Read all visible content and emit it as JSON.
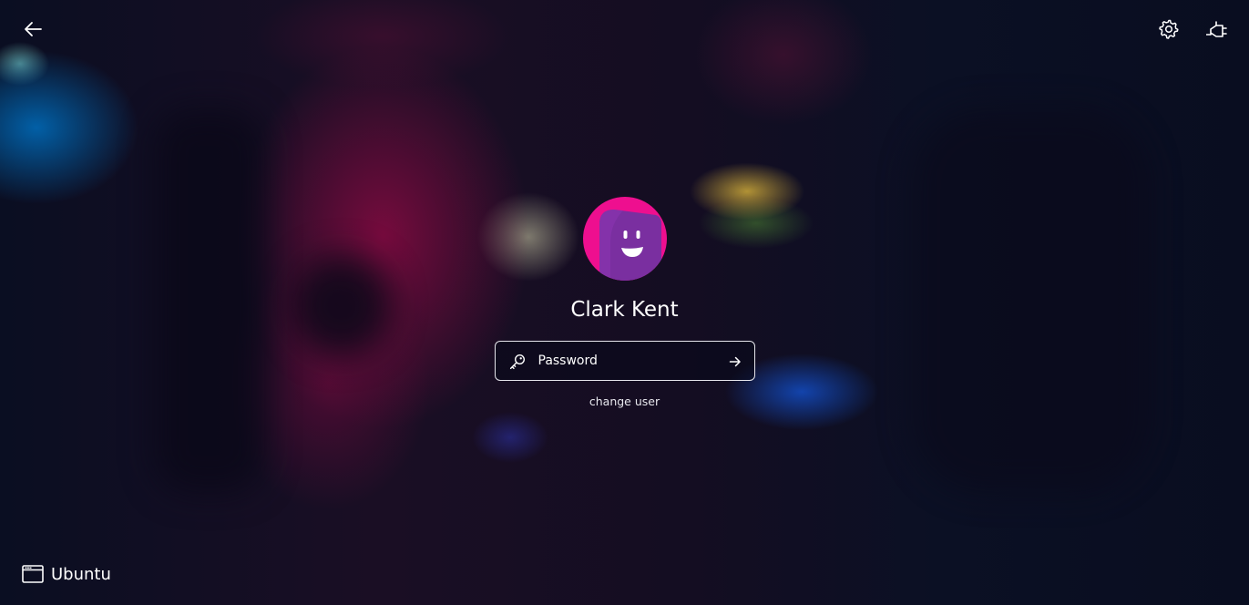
{
  "header": {
    "back_icon": "arrow-left-icon",
    "settings_icon": "gear-icon",
    "accessibility_icon": "power-plug-icon"
  },
  "user": {
    "name": "Clark Kent",
    "avatar_icon": "smiley-avatar-icon",
    "avatar_colors": {
      "background": "#ee0f8f",
      "face": "#7a2fa0"
    }
  },
  "login": {
    "password_placeholder": "Password",
    "password_value": "",
    "key_icon": "key-icon",
    "submit_icon": "arrow-right-icon",
    "change_user_label": "change user"
  },
  "session": {
    "icon": "window-icon",
    "label": "Ubuntu"
  }
}
